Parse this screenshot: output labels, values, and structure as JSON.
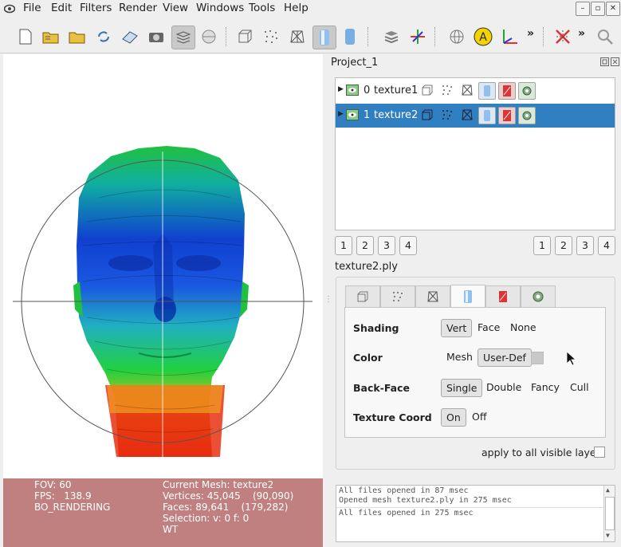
{
  "menu": [
    "File",
    "Edit",
    "Filters",
    "Render",
    "View",
    "Windows",
    "Tools",
    "Help"
  ],
  "toolbar": {
    "icons": [
      "new-project",
      "open-project",
      "open-mesh",
      "reload",
      "save",
      "snapshot",
      "layers",
      "sphere-tool",
      "bbox",
      "points",
      "wireframe",
      "flat-lines",
      "smooth",
      "layer-stack",
      "axes",
      "globe",
      "annotation-a",
      "xyz-axes",
      "more",
      "selection-tool",
      "more2",
      "zoom"
    ],
    "overflow": "»"
  },
  "viewport": {
    "background": "#ffffff"
  },
  "info": {
    "fov": "FOV: 60",
    "fps": "FPS:   138.9",
    "mode": "BO_RENDERING",
    "current_mesh": "Current Mesh: texture2",
    "vertices": "Vertices: 45,045    (90,090)",
    "faces": "Faces: 89,641    (179,282)",
    "selection": "Selection: v: 0 f: 0",
    "wt": "WT",
    "color": "#c08080"
  },
  "panel": {
    "title": "Project_1",
    "layers": [
      {
        "index": "0",
        "name": "texture1"
      },
      {
        "index": "1",
        "name": "texture2"
      }
    ],
    "num_left": [
      "1",
      "2",
      "3",
      "4"
    ],
    "num_right": [
      "1",
      "2",
      "3",
      "4"
    ],
    "mesh_name": "texture2.ply"
  },
  "props": {
    "shading": {
      "label": "Shading",
      "options": [
        "Vert",
        "Face",
        "None"
      ],
      "selected": "Vert"
    },
    "color": {
      "label": "Color",
      "options": [
        "Mesh",
        "User-Def"
      ],
      "selected": "User-Def"
    },
    "backface": {
      "label": "Back-Face",
      "options": [
        "Single",
        "Double",
        "Fancy",
        "Cull"
      ],
      "selected": "Single"
    },
    "texcoord": {
      "label": "Texture Coord",
      "options": [
        "On",
        "Off"
      ],
      "selected": "On"
    },
    "apply_all": "apply to all visible layers"
  },
  "log": [
    "All files opened in 87 msec",
    "Opened mesh texture2.ply in 275 msec",
    "All files opened in 275 msec"
  ],
  "colors": {
    "selection": "#2f7fc1",
    "accent_yellow": "#f3d400"
  }
}
